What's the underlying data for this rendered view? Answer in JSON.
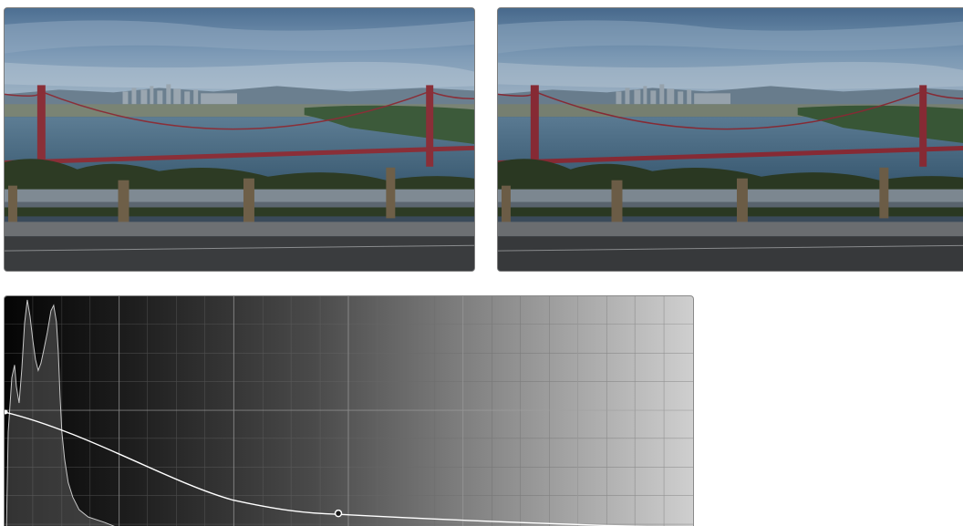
{
  "viewers": {
    "before": {
      "label": "",
      "icon": "golden-gate-bridge-photo"
    },
    "after": {
      "label": "",
      "icon": "golden-gate-bridge-photo"
    }
  },
  "curve_editor": {
    "type": "luminance-vs-saturation",
    "histogram": "luma-histogram",
    "control_point": {
      "input": 0.485,
      "output": 0.06
    },
    "curve_color": "#ffffff",
    "grid_color": "#6a6a6a"
  }
}
